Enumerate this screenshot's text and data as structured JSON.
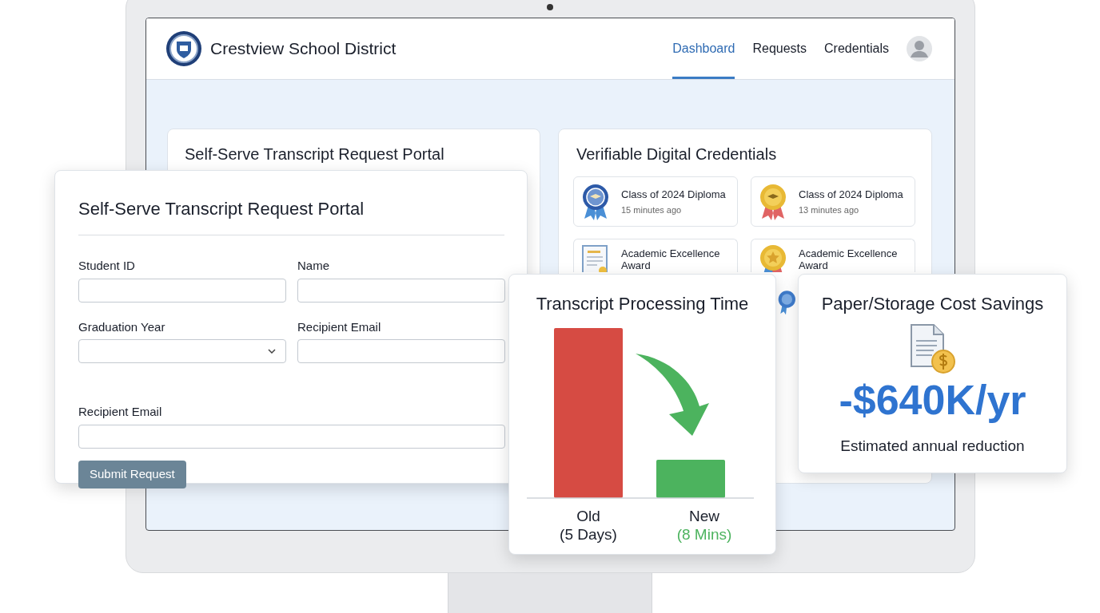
{
  "app": {
    "title": "Crestview School District",
    "nav": [
      {
        "label": "Dashboard",
        "selected": true
      },
      {
        "label": "Requests",
        "selected": false
      },
      {
        "label": "Credentials",
        "selected": false
      }
    ]
  },
  "portal_background": {
    "title": "Self-Serve Transcript Request Portal"
  },
  "credentials": {
    "title": "Verifiable Digital Credentials",
    "items": [
      {
        "kind": "blue-ribbon",
        "title": "Class of 2024 Diploma",
        "time": "15 minutes ago"
      },
      {
        "kind": "gold-ribbon",
        "title": "Class of 2024 Diploma",
        "time": "13 minutes ago"
      },
      {
        "kind": "certificate",
        "title": "Academic Excellence Award"
      },
      {
        "kind": "star-medal",
        "title": "Academic Excellence Award"
      },
      {
        "kind": "blue-seal"
      }
    ]
  },
  "form": {
    "title": "Self-Serve Transcript Request Portal",
    "fields": [
      {
        "label": "Student ID",
        "kind": "text",
        "full_width": false
      },
      {
        "label": "Name",
        "kind": "text",
        "full_width": false
      },
      {
        "label": "Graduation Year",
        "kind": "select",
        "full_width": false
      },
      {
        "label": "Recipient Email",
        "kind": "text",
        "full_width": false
      },
      {
        "label": "Recipient Email",
        "kind": "text",
        "full_width": true
      }
    ],
    "submit": "Submit Request"
  },
  "processing": {
    "title": "Transcript Processing Time",
    "categories": [
      {
        "label": "Old",
        "detail": "(5 Days)",
        "color": "#d64b43",
        "highlight": false
      },
      {
        "label": "New",
        "detail": "(8 Mins)",
        "color": "#4cb35e",
        "highlight": true
      }
    ]
  },
  "savings": {
    "title": "Paper/Storage Cost Savings",
    "value": "-$640K/yr",
    "caption": "Estimated annual reduction"
  }
}
